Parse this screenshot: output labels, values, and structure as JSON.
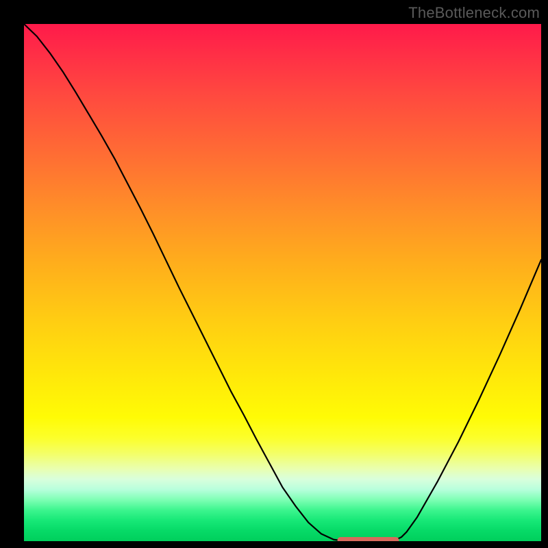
{
  "watermark": {
    "text": "TheBottleneck.com"
  },
  "chart_data": {
    "type": "line",
    "title": "",
    "xlabel": "",
    "ylabel": "",
    "xlim": [
      0,
      100
    ],
    "ylim": [
      0,
      100
    ],
    "grid": false,
    "x": [
      0.0,
      2.5,
      5.0,
      7.5,
      10.0,
      12.5,
      15.0,
      17.5,
      20.0,
      22.5,
      25.0,
      27.5,
      30.0,
      32.5,
      35.0,
      37.5,
      40.0,
      42.5,
      45.0,
      47.5,
      50.0,
      52.5,
      55.0,
      57.5,
      59.9,
      61.2,
      62.0,
      63.0,
      65.0,
      67.0,
      69.0,
      70.6,
      71.9,
      73.0,
      74.0,
      76.0,
      80.0,
      84.0,
      88.0,
      92.0,
      96.0,
      100.0
    ],
    "values": [
      100.0,
      97.6,
      94.4,
      90.8,
      86.8,
      82.6,
      78.4,
      74.0,
      69.2,
      64.4,
      59.4,
      54.2,
      49.0,
      44.0,
      39.0,
      34.0,
      29.0,
      24.4,
      19.6,
      15.0,
      10.4,
      6.8,
      3.6,
      1.4,
      0.3,
      0.13,
      0.13,
      0.13,
      0.13,
      0.13,
      0.13,
      0.13,
      0.27,
      0.8,
      1.8,
      4.6,
      11.6,
      19.2,
      27.4,
      36.0,
      45.0,
      54.4
    ],
    "valley_marker": {
      "color": "#d86a5c",
      "x_start": 61.2,
      "x_end": 71.9,
      "y": 0.2
    },
    "background": {
      "type": "vertical-gradient",
      "stops": [
        {
          "pos": 0.0,
          "color": "#ff1a4a"
        },
        {
          "pos": 0.5,
          "color": "#ffc016"
        },
        {
          "pos": 0.76,
          "color": "#fffb05"
        },
        {
          "pos": 1.0,
          "color": "#00cf5c"
        }
      ]
    }
  }
}
